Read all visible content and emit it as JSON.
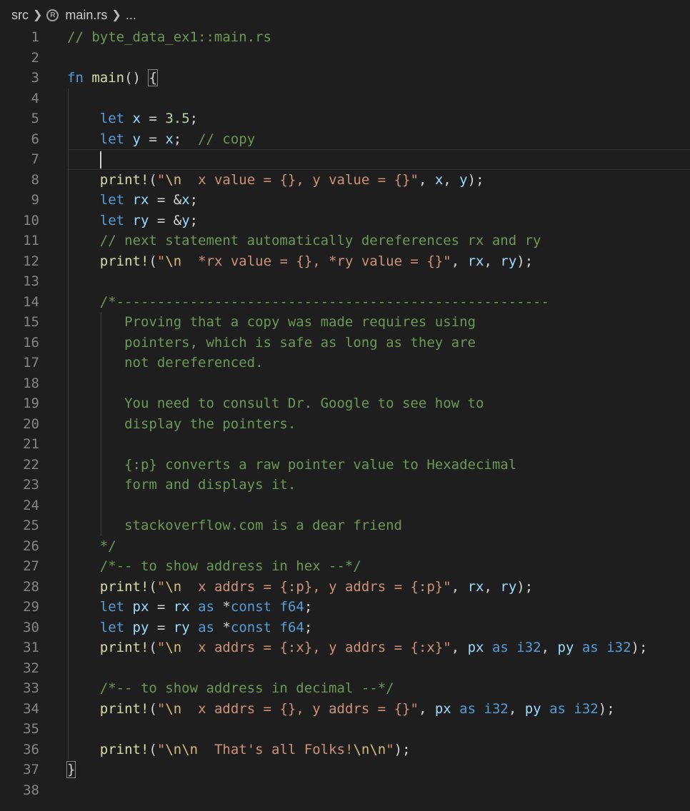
{
  "breadcrumb": {
    "folder": "src",
    "file": "main.rs",
    "more": "...",
    "file_icon": "rust-icon"
  },
  "editor": {
    "language": "rust",
    "cursor_line": 7,
    "lines": [
      "// byte_data_ex1::main.rs",
      "",
      "fn main() {",
      "",
      "    let x = 3.5;",
      "    let y = x;  // copy",
      "    ",
      "    print!(\"\\n  x value = {}, y value = {}\", x, y);",
      "    let rx = &x;",
      "    let ry = &y;",
      "    // next statement automatically dereferences rx and ry",
      "    print!(\"\\n  *rx value = {}, *ry value = {}\", rx, ry);",
      "",
      "    /*-----------------------------------------------------",
      "       Proving that a copy was made requires using",
      "       pointers, which is safe as long as they are",
      "       not dereferenced.",
      "",
      "       You need to consult Dr. Google to see how to",
      "       display the pointers.",
      "",
      "       {:p} converts a raw pointer value to Hexadecimal",
      "       form and displays it.",
      "",
      "       stackoverflow.com is a dear friend",
      "    */",
      "    /*-- to show address in hex --*/",
      "    print!(\"\\n  x addrs = {:p}, y addrs = {:p}\", rx, ry);",
      "    let px = rx as *const f64;",
      "    let py = ry as *const f64;",
      "    print!(\"\\n  x addrs = {:x}, y addrs = {:x}\", px as i32, py as i32);",
      "",
      "    /*-- to show address in decimal --*/",
      "    print!(\"\\n  x addrs = {}, y addrs = {}\", px as i32, py as i32);",
      "",
      "    print!(\"\\n\\n  That's all Folks!\\n\\n\");",
      "}",
      ""
    ]
  }
}
